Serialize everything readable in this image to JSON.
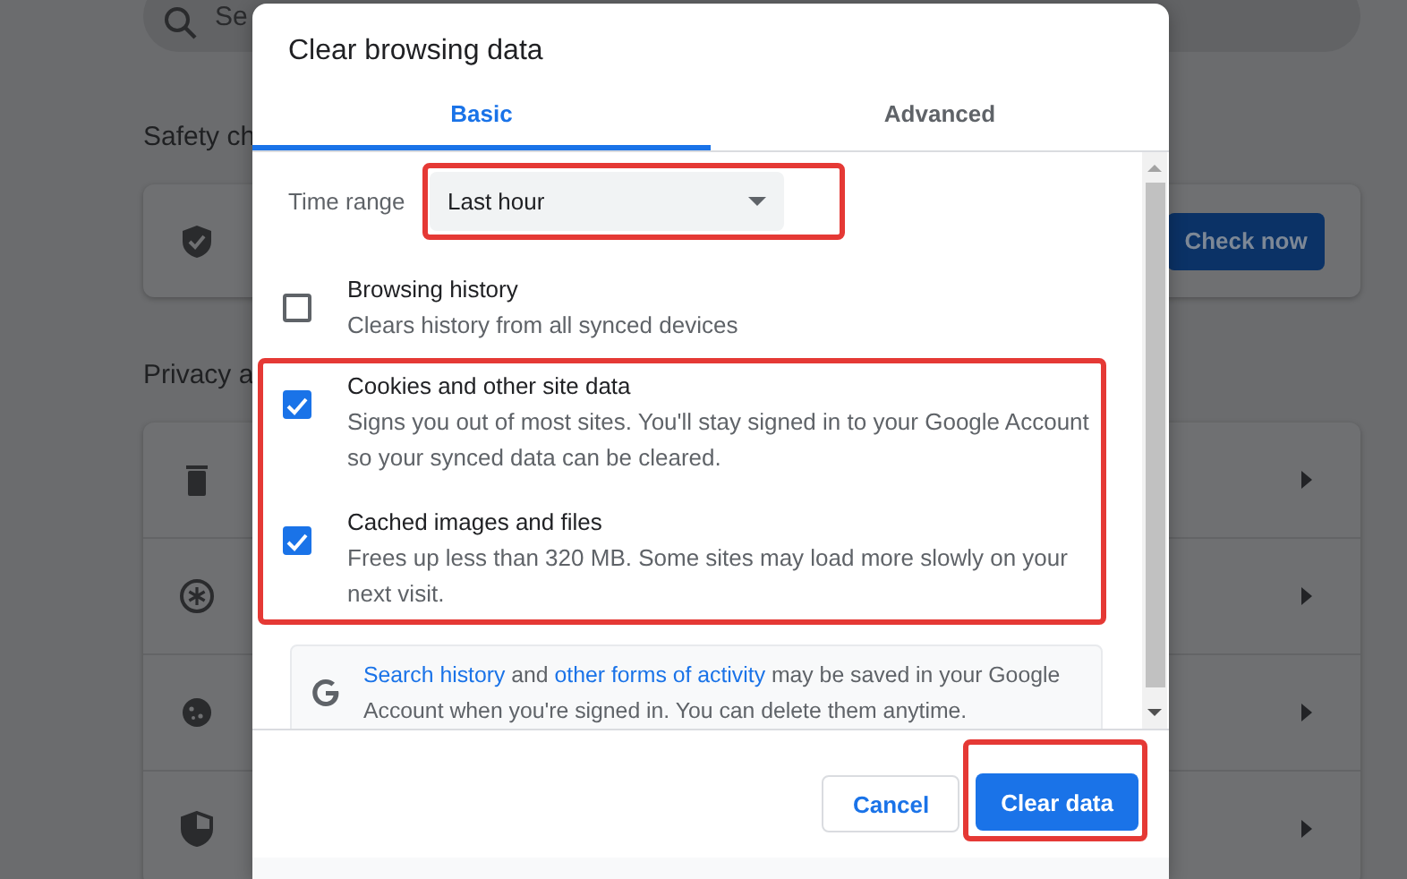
{
  "background": {
    "search": {
      "placeholder": "Se"
    },
    "sections": [
      {
        "title": "Safety ch",
        "rows": [
          {
            "button": "Check now"
          }
        ]
      },
      {
        "title": "Privacy a",
        "rows": [
          {
            "kind": "link"
          },
          {
            "kind": "link"
          },
          {
            "kind": "link"
          },
          {
            "kind": "link"
          }
        ]
      }
    ]
  },
  "dialog": {
    "title": "Clear browsing data",
    "tabs": [
      {
        "label": "Basic",
        "selected": true
      },
      {
        "label": "Advanced",
        "selected": false
      }
    ],
    "time_range": {
      "label": "Time range",
      "value": "Last hour",
      "highlighted": true
    },
    "items": [
      {
        "title": "Browsing history",
        "description": "Clears history from all synced devices",
        "checked": false,
        "highlighted": false
      },
      {
        "title": "Cookies and other site data",
        "description": "Signs you out of most sites. You'll stay signed in to your Google Account so your synced data can be cleared.",
        "checked": true,
        "highlighted": true
      },
      {
        "title": "Cached images and files",
        "description": "Frees up less than 320 MB. Some sites may load more slowly on your next visit.",
        "checked": true,
        "highlighted": true
      }
    ],
    "notice": [
      {
        "text": "Search history",
        "link": true
      },
      {
        "text": " and ",
        "link": false
      },
      {
        "text": "other forms of activity",
        "link": true
      },
      {
        "text": " may be saved in your Google Account when you're signed in. You can delete them anytime.",
        "link": false
      }
    ],
    "buttons": [
      {
        "label": "Cancel",
        "kind": "secondary",
        "highlighted": false
      },
      {
        "label": "Clear data",
        "kind": "primary",
        "highlighted": true
      }
    ]
  }
}
